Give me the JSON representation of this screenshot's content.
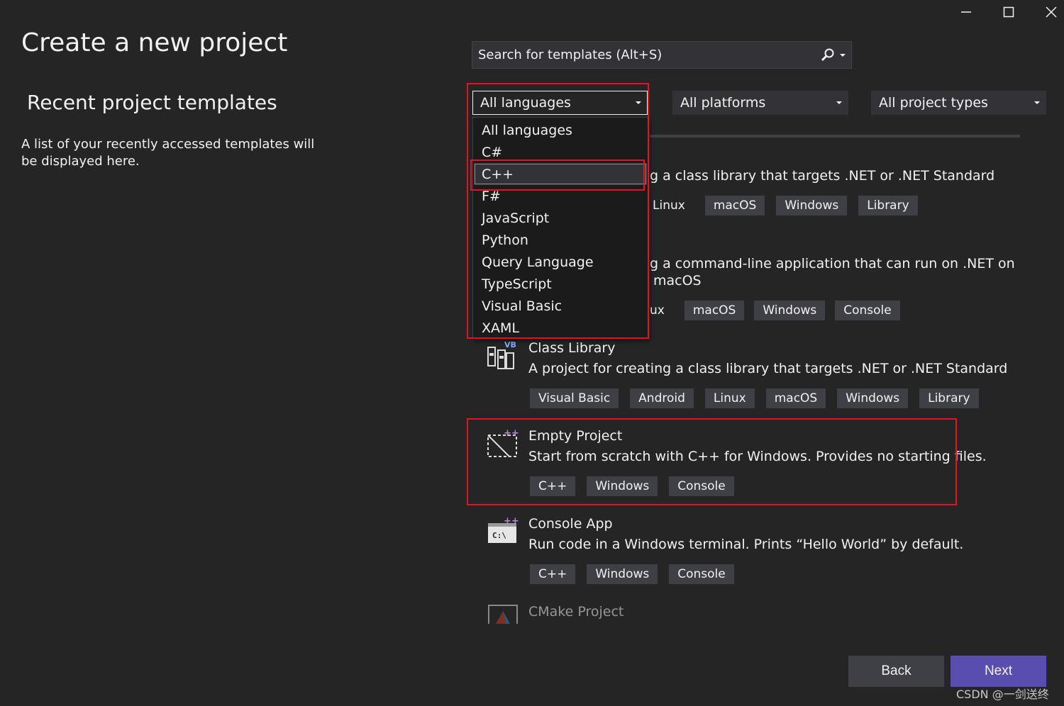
{
  "window": {
    "minimize_icon": "minimize-icon",
    "maximize_icon": "maximize-icon",
    "close_icon": "close-icon"
  },
  "left": {
    "title": "Create a new project",
    "recent_title": "Recent project templates",
    "recent_desc": "A list of your recently accessed templates will be displayed here."
  },
  "search": {
    "placeholder": "Search for templates (Alt+S)"
  },
  "filters": {
    "language": "All languages",
    "platform": "All platforms",
    "project_type": "All project types"
  },
  "language_menu": {
    "items": [
      "All languages",
      "C#",
      "C++",
      "F#",
      "JavaScript",
      "Python",
      "Query Language",
      "TypeScript",
      "Visual Basic",
      "XAML"
    ],
    "highlighted": "C++"
  },
  "templates": [
    {
      "title": "",
      "desc_visible": "g a class library that targets .NET or .NET Standard",
      "tags": [
        "Linux",
        "macOS",
        "Windows",
        "Library"
      ]
    },
    {
      "title": "",
      "desc_line1_visible": "g a command-line application that can run on .NET on",
      "desc_line2_visible": "macOS",
      "tags": [
        "ux",
        "macOS",
        "Windows",
        "Console"
      ]
    },
    {
      "title": "Class Library",
      "desc": "A project for creating a class library that targets .NET or .NET Standard",
      "icon_badge": "VB",
      "tags": [
        "Visual Basic",
        "Android",
        "Linux",
        "macOS",
        "Windows",
        "Library"
      ]
    },
    {
      "title": "Empty Project",
      "desc": "Start from scratch with C++ for Windows. Provides no starting files.",
      "icon_badge": "++",
      "tags": [
        "C++",
        "Windows",
        "Console"
      ]
    },
    {
      "title": "Console App",
      "desc": "Run code in a Windows terminal. Prints “Hello World” by default.",
      "icon_badge": "++",
      "icon_text": "C:\\",
      "tags": [
        "C++",
        "Windows",
        "Console"
      ]
    },
    {
      "title": "CMake Project",
      "desc": "",
      "tags": []
    }
  ],
  "buttons": {
    "back": "Back",
    "next": "Next"
  },
  "watermark": "CSDN @一剑送终",
  "colors": {
    "background": "#252526",
    "accent": "#5a4db0",
    "annotation_red": "#e81123",
    "tag_bg": "#3f3f46"
  }
}
